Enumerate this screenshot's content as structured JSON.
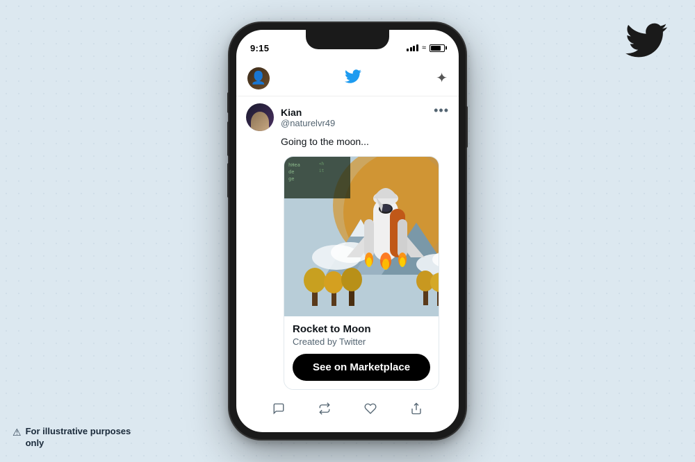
{
  "page": {
    "background_color": "#dce8f0"
  },
  "twitter_corner_icon": "🐦",
  "disclaimer": {
    "icon": "⚠",
    "text": "For illustrative purposes only"
  },
  "phone": {
    "status_bar": {
      "time": "9:15"
    },
    "nav": {
      "sparkle_label": "✦"
    },
    "tweet": {
      "author_name": "Kian",
      "author_handle": "@naturelvr49",
      "more_icon": "•••",
      "text": "Going to the moon...",
      "nft": {
        "title": "Rocket to Moon",
        "creator": "Created by Twitter",
        "button_label": "See on Marketplace"
      },
      "actions": {
        "reply_icon": "💬",
        "retweet_icon": "🔁",
        "like_icon": "🤍",
        "share_icon": "↑"
      }
    }
  }
}
